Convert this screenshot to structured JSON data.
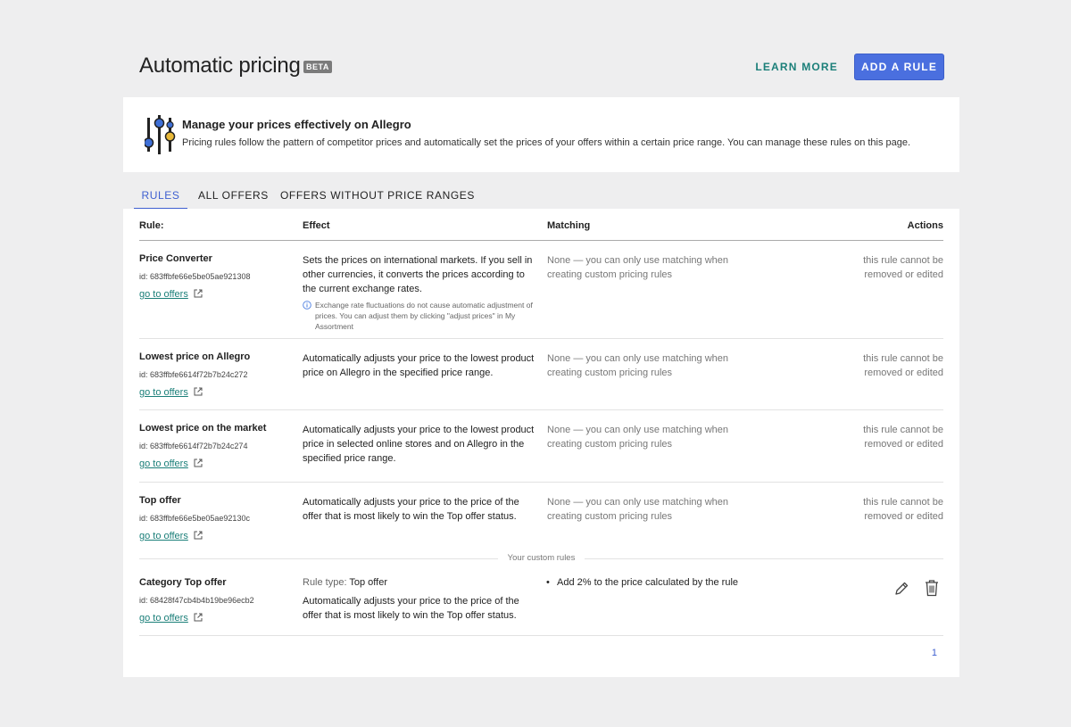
{
  "header": {
    "title": "Automatic pricing",
    "badge": "BETA",
    "learn_more": "LEARN MORE",
    "add_rule": "ADD A RULE"
  },
  "info": {
    "title": "Manage your prices effectively on Allegro",
    "text": "Pricing rules follow the pattern of competitor prices and automatically set the prices of your offers within a certain price range. You can manage these rules on this page."
  },
  "tabs": [
    "RULES",
    "ALL OFFERS",
    "OFFERS WITHOUT PRICE RANGES"
  ],
  "table": {
    "headers": {
      "rule": "Rule:",
      "effect": "Effect",
      "matching": "Matching",
      "actions": "Actions"
    },
    "rows": [
      {
        "name": "Price Converter",
        "id": "id: 683ffbfe66e5be05ae921308",
        "link": "go to offers",
        "effect": "Sets the prices on international markets. If you sell in other currencies, it converts the prices according to the current exchange rates.",
        "note": "Exchange rate fluctuations do not cause automatic adjustment of prices. You can adjust them by clicking \"adjust prices\" in My Assortment",
        "matching": "None — you can only use matching when creating custom pricing rules",
        "actions": "this rule cannot be removed or edited"
      },
      {
        "name": "Lowest price on Allegro",
        "id": "id: 683ffbfe6614f72b7b24c272",
        "link": "go to offers",
        "effect": "Automatically adjusts your price to the lowest product price on Allegro in the specified price range.",
        "matching": "None — you can only use matching when creating custom pricing rules",
        "actions": "this rule cannot be removed or edited"
      },
      {
        "name": "Lowest price on the market",
        "id": "id: 683ffbfe6614f72b7b24c274",
        "link": "go to offers",
        "effect": "Automatically adjusts your price to the lowest product price in selected online stores and on Allegro in the specified price range.",
        "matching": "None — you can only use matching when creating custom pricing rules",
        "actions": "this rule cannot be removed or edited"
      },
      {
        "name": "Top offer",
        "id": "id: 683ffbfe66e5be05ae92130c",
        "link": "go to offers",
        "effect": "Automatically adjusts your price to the price of the offer that is most likely to win the Top offer status.",
        "matching": "None — you can only use matching when creating custom pricing rules",
        "actions": "this rule cannot be removed or edited"
      }
    ],
    "custom_divider": "Your custom rules",
    "custom_rows": [
      {
        "name": "Category Top offer",
        "id": "id: 68428f47cb4b4b19be96ecb2",
        "link": "go to offers",
        "rule_type_label": "Rule type:",
        "rule_type_value": "Top offer",
        "effect": "Automatically adjusts your price to the price of the offer that is most likely to win the Top offer status.",
        "matching_bullet": "Add 2% to the price calculated by the rule"
      }
    ]
  },
  "pagination": {
    "current": "1"
  },
  "colors": {
    "accent_blue": "#4a6fdf",
    "link_teal": "#1b7f79",
    "background": "#eeeeef"
  },
  "icons": [
    "sliders-icon",
    "external-link-icon",
    "info-circle-icon",
    "pencil-icon",
    "trash-icon"
  ]
}
